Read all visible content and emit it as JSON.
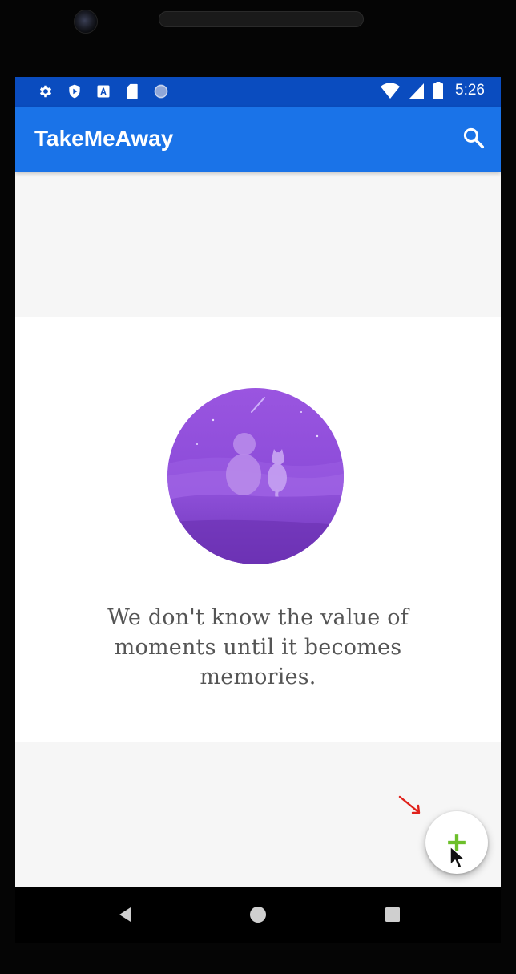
{
  "status_bar": {
    "left_icons": [
      "settings-icon",
      "shield-play-icon",
      "keyboard-a-icon",
      "sd-card-icon",
      "circle-notification-icon"
    ],
    "right_icons": [
      "wifi-icon",
      "signal-icon",
      "battery-icon"
    ],
    "time": "5:26"
  },
  "app_bar": {
    "title": "TakeMeAway",
    "search_icon": "search-icon"
  },
  "main": {
    "empty_state": {
      "illustration": "person-and-cat-night-sky-illustration",
      "quote": "We don't know the value of moments until it becomes memories."
    }
  },
  "fab": {
    "icon": "plus-icon",
    "color": "#6cbf2a"
  },
  "nav_bar": {
    "buttons": [
      "back-icon",
      "home-icon",
      "recents-icon"
    ]
  },
  "colors": {
    "status_bar": "#0a4cbf",
    "app_bar": "#1a73e8",
    "background": "#f6f6f6",
    "illustration_purple": "#8c4fd6"
  }
}
